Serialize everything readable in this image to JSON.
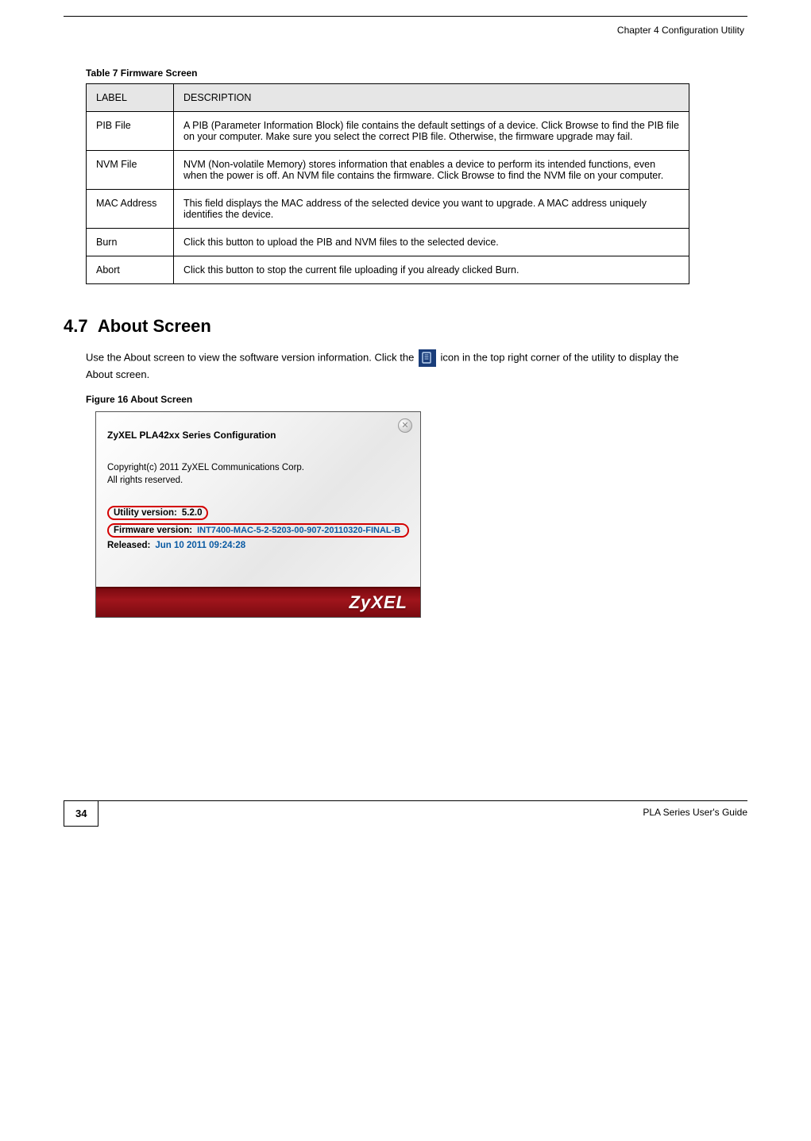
{
  "header": {
    "chapter": "Chapter 4 Configuration Utility"
  },
  "table": {
    "caption": "Table 7   Firmware Screen",
    "headers": {
      "label": "LABEL",
      "desc": "DESCRIPTION"
    },
    "rows": [
      {
        "label": "PIB File",
        "desc": "A PIB (Parameter Information Block) file contains the default settings of a device. Click Browse to find the PIB file on your computer. Make sure you select the correct PIB file. Otherwise, the firmware upgrade may fail."
      },
      {
        "label": "NVM File",
        "desc": "NVM (Non-volatile Memory) stores information that enables a device to perform its intended functions, even when the power is off. An NVM file contains the firmware. Click Browse to find the NVM file on your computer."
      },
      {
        "label": "MAC Address",
        "desc": "This field displays the MAC address of the selected device you want to upgrade. A MAC address uniquely identifies the device."
      },
      {
        "label": "Burn",
        "desc": "Click this button to upload the PIB and NVM files to the selected device."
      },
      {
        "label": "Abort",
        "desc": "Click this button to stop the current file uploading if you already clicked Burn."
      }
    ]
  },
  "section": {
    "number": "4.7",
    "title": "About Screen",
    "para1_pre": "Use the About screen to view the software version information. Click the ",
    "para1_post": " icon in the top right corner of the utility to display the About screen.",
    "figure_caption": "Figure 16   About Screen"
  },
  "about_dialog": {
    "title": "ZyXEL PLA42xx Series Configuration",
    "copyright": "Copyright(c) 2011 ZyXEL Communications Corp.",
    "rights": "All rights reserved.",
    "utility_label": "Utility version:",
    "utility_value": "5.2.0",
    "firmware_label": "Firmware version:",
    "firmware_value": "INT7400-MAC-5-2-5203-00-907-20110320-FINAL-B",
    "released_label": "Released:",
    "released_value": "Jun 10 2011 09:24:28",
    "logo": "ZyXEL"
  },
  "footer": {
    "page_number": "34",
    "guide": "PLA Series User's Guide"
  }
}
